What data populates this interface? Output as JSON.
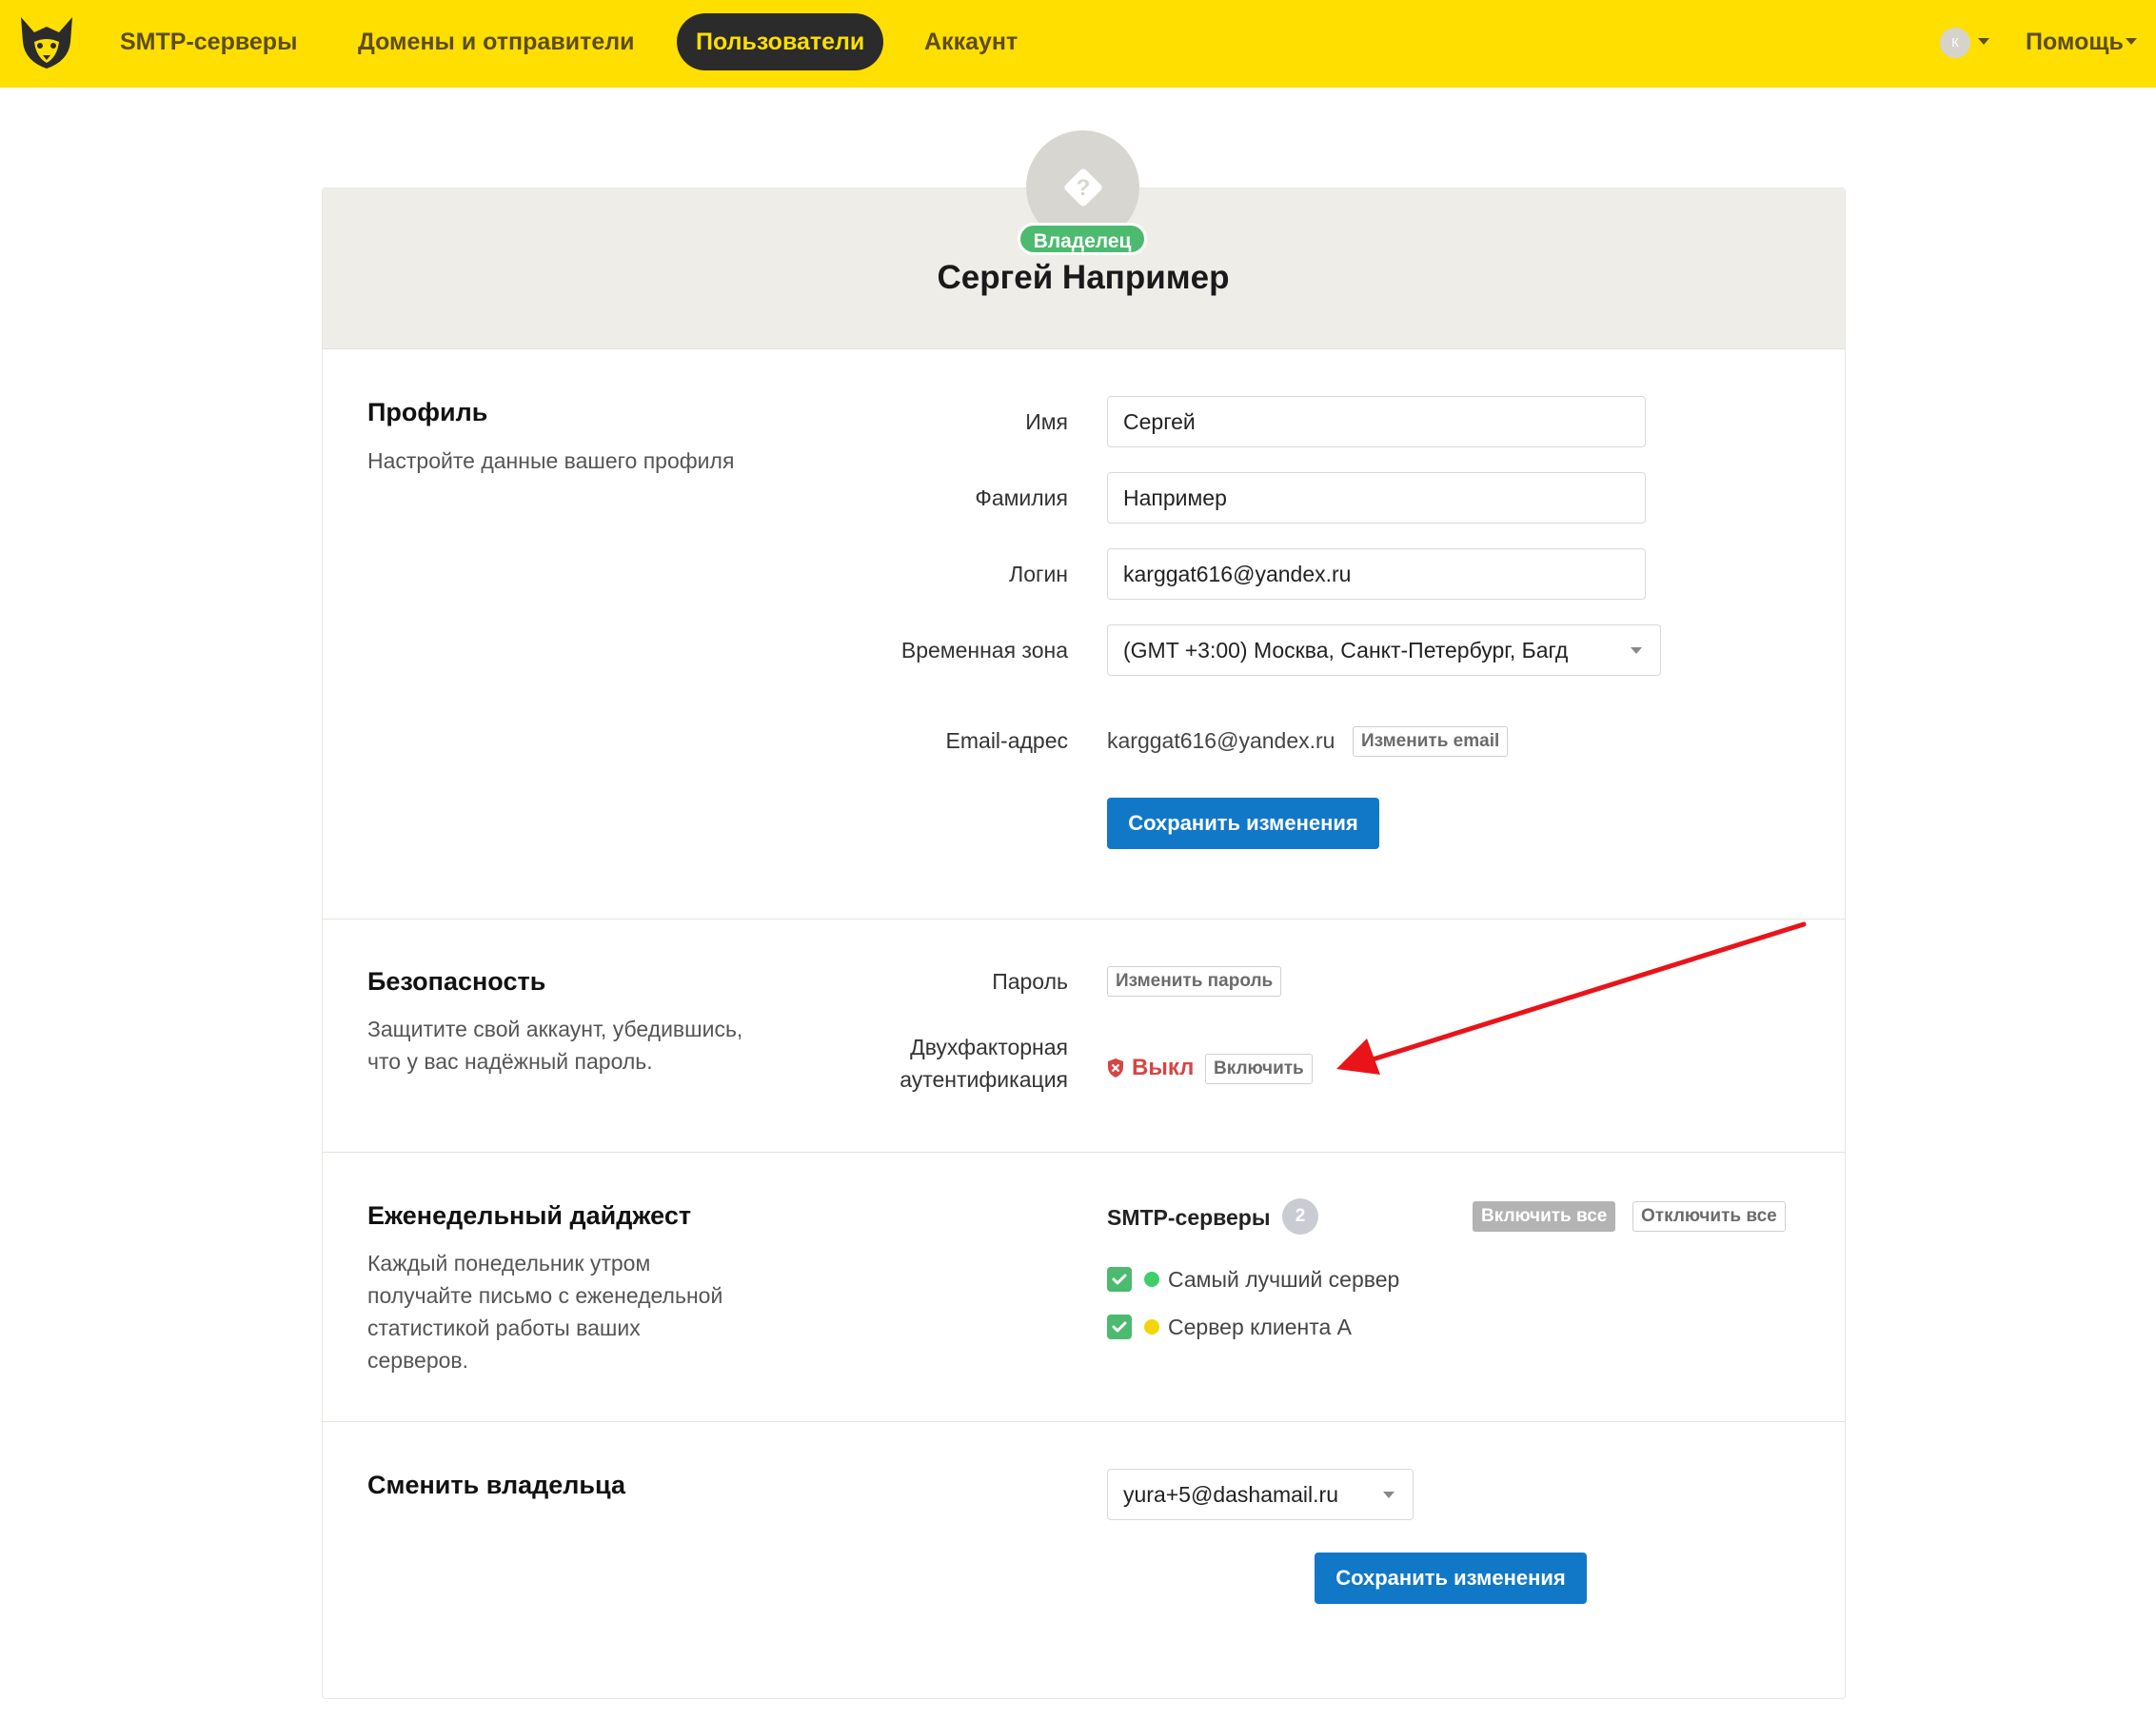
{
  "nav": {
    "items": [
      {
        "label": "SMTP-серверы"
      },
      {
        "label": "Домены и отправители"
      },
      {
        "label": "Пользователи"
      },
      {
        "label": "Аккаунт"
      }
    ],
    "user_initial": "К",
    "help_label": "Помощь"
  },
  "header": {
    "badge": "Владелец",
    "name": "Сергей Например"
  },
  "profile": {
    "title": "Профиль",
    "description": "Настройте данные вашего профиля",
    "first_name_label": "Имя",
    "first_name_value": "Сергей",
    "last_name_label": "Фамилия",
    "last_name_value": "Например",
    "login_label": "Логин",
    "login_value": "karggat616@yandex.ru",
    "timezone_label": "Временная зона",
    "timezone_value": "(GMT +3:00) Москва, Санкт-Петербург, Багд",
    "email_label": "Email-адрес",
    "email_value": "karggat616@yandex.ru",
    "change_email_label": "Изменить email",
    "save_label": "Сохранить изменения"
  },
  "security": {
    "title": "Безопасность",
    "description_line1": "Защитите свой аккаунт, убедившись,",
    "description_line2": "что у вас надёжный пароль.",
    "password_label": "Пароль",
    "change_password_label": "Изменить пароль",
    "twofa_label_line1": "Двухфакторная",
    "twofa_label_line2": "аутентификация",
    "twofa_status": "Выкл",
    "enable_label": "Включить",
    "status_color": "#d64545"
  },
  "digest": {
    "title": "Еженедельный дайджест",
    "description_lines": [
      "Каждый понедельник утром",
      "получайте письмо с еженедельной",
      "статистикой работы ваших",
      "серверов."
    ],
    "servers_label": "SMTP-серверы",
    "servers_count": "2",
    "enable_all_label": "Включить все",
    "disable_all_label": "Отключить все",
    "servers": [
      {
        "name": "Самый лучший сервер",
        "checked": true,
        "status_color": "#3ecf6a"
      },
      {
        "name": "Сервер клиента А",
        "checked": true,
        "status_color": "#f2d60a"
      }
    ]
  },
  "owner_change": {
    "title": "Сменить владельца",
    "selected": "yura+5@dashamail.ru",
    "save_label": "Сохранить изменения"
  },
  "colors": {
    "topbar": "#ffdf00",
    "primary": "#1178c8",
    "success": "#4cba6f",
    "annotation_arrow": "#e8141a"
  }
}
